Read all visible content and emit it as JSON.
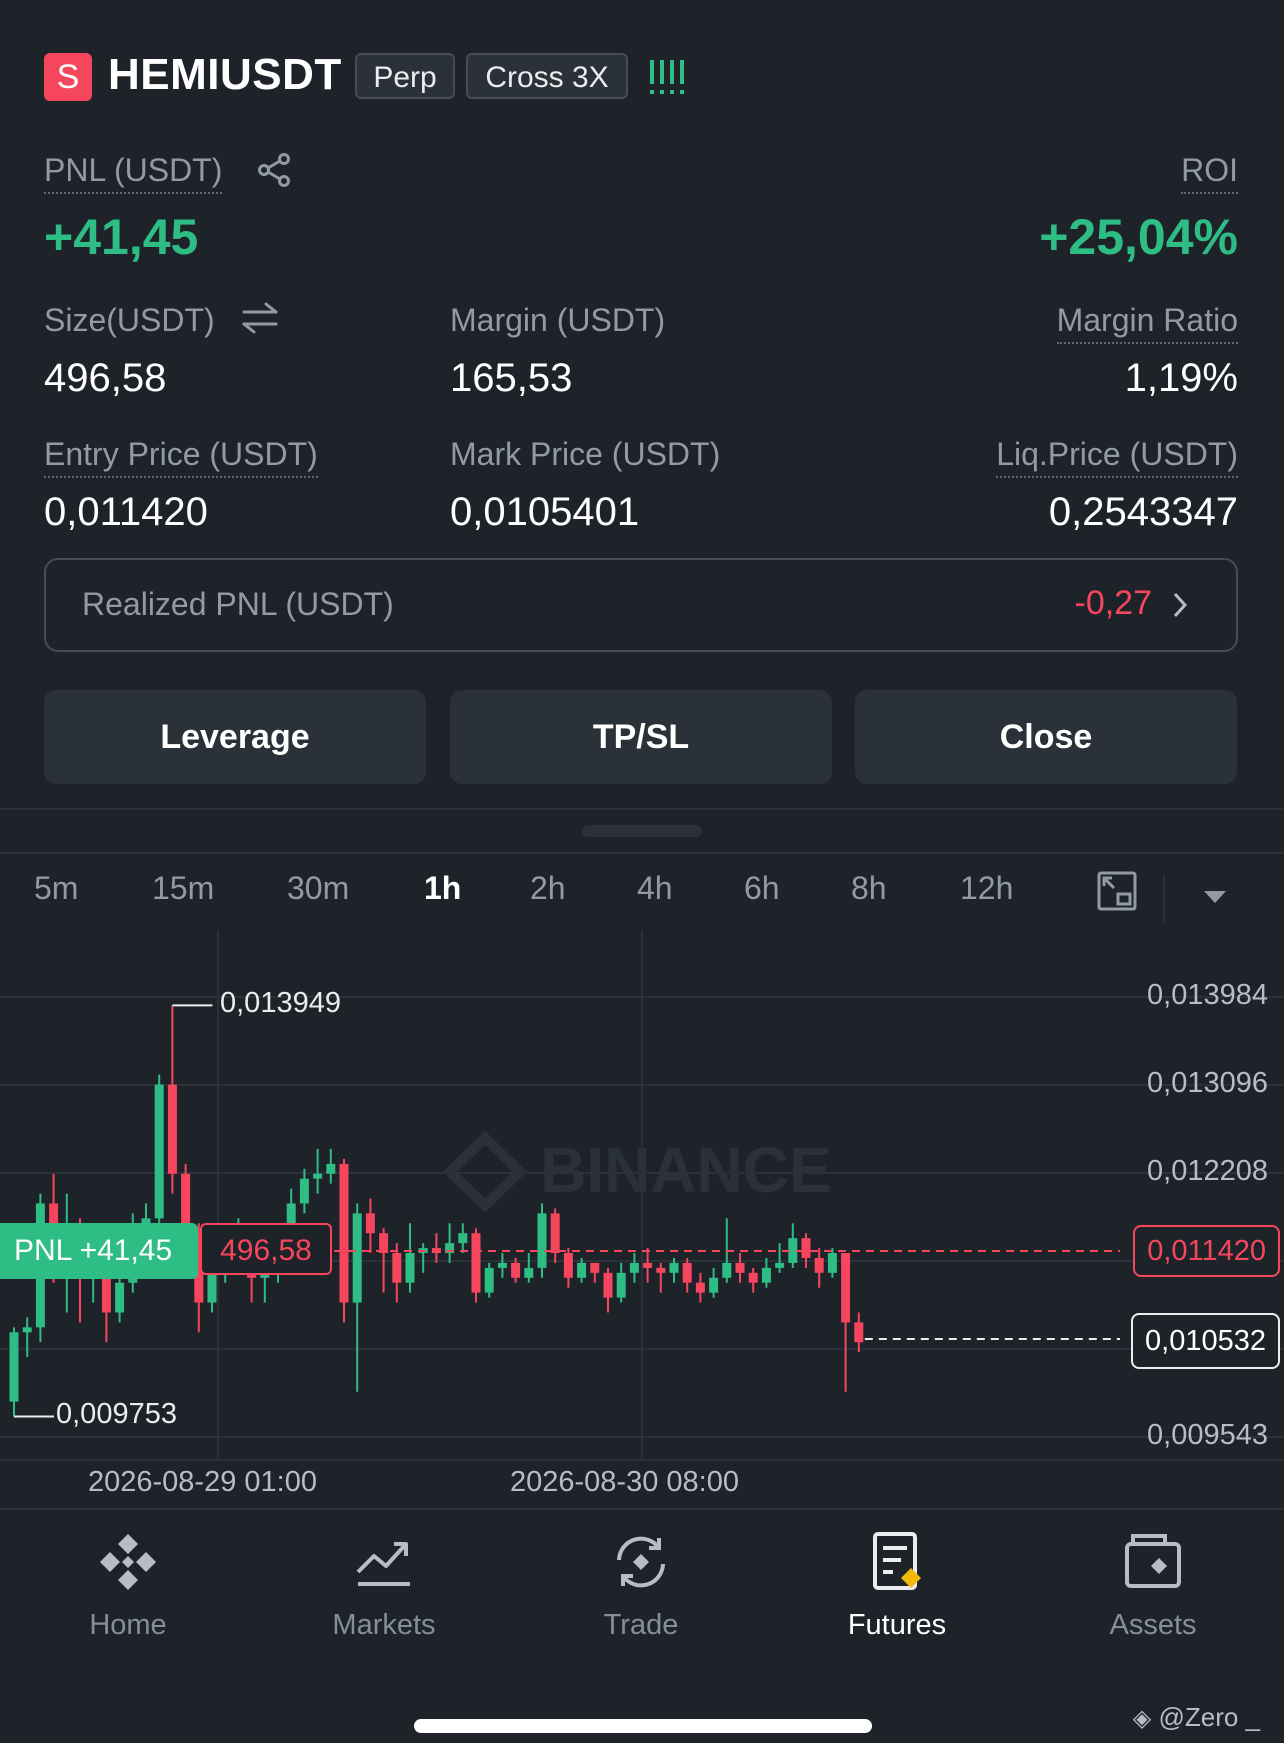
{
  "header": {
    "symbol_badge": "S",
    "symbol": "HEMIUSDT",
    "type_tag": "Perp",
    "margin_tag": "Cross 3X"
  },
  "position": {
    "pnl_label": "PNL (USDT)",
    "pnl_value": "+41,45",
    "roi_label": "ROI",
    "roi_value": "+25,04%",
    "size_label": "Size(USDT)",
    "size_value": "496,58",
    "margin_label": "Margin (USDT)",
    "margin_value": "165,53",
    "margin_ratio_label": "Margin Ratio",
    "margin_ratio_value": "1,19%",
    "entry_label": "Entry Price (USDT)",
    "entry_value": "0,011420",
    "mark_label": "Mark Price (USDT)",
    "mark_value": "0,0105401",
    "liq_label": "Liq.Price (USDT)",
    "liq_value": "0,2543347",
    "realized_label": "Realized PNL (USDT)",
    "realized_value": "-0,27"
  },
  "actions": {
    "leverage": "Leverage",
    "tpsl": "TP/SL",
    "close": "Close"
  },
  "timeframes": [
    "5m",
    "15m",
    "30m",
    "1h",
    "2h",
    "4h",
    "6h",
    "8h",
    "12h"
  ],
  "active_timeframe": "1h",
  "chart_data": {
    "type": "candlestick",
    "watermark": "BINANCE",
    "price_ticks": [
      "0,013984",
      "0,013096",
      "0,012208",
      "0,011420",
      "0,010532",
      "0,009543"
    ],
    "time_ticks": [
      "2026-08-29 01:00",
      "2026-08-30 08:00"
    ],
    "high_label": "0,013949",
    "low_label": "0,009753",
    "entry_line": {
      "price": 0.01142,
      "label": "0,011420",
      "pnl_tag": "PNL +41,45",
      "size_tag": "496,58"
    },
    "last_price": {
      "price": 0.010532,
      "label": "0,010532"
    },
    "ylim": [
      0.009543,
      0.013984
    ],
    "candles": [
      [
        0.0099,
        0.0106,
        0.00975,
        0.01065
      ],
      [
        0.0106,
        0.01065,
        0.01035,
        0.01075
      ],
      [
        0.01065,
        0.0119,
        0.0105,
        0.012
      ],
      [
        0.0119,
        0.0113,
        0.0111,
        0.0122
      ],
      [
        0.0113,
        0.0117,
        0.0108,
        0.012
      ],
      [
        0.0117,
        0.0112,
        0.0107,
        0.01175
      ],
      [
        0.0112,
        0.0113,
        0.0109,
        0.0116
      ],
      [
        0.0113,
        0.0108,
        0.0105,
        0.0114
      ],
      [
        0.0108,
        0.0111,
        0.0107,
        0.01135
      ],
      [
        0.0111,
        0.0116,
        0.011,
        0.0118
      ],
      [
        0.0116,
        0.01175,
        0.0114,
        0.0119
      ],
      [
        0.01175,
        0.0131,
        0.0116,
        0.0132
      ],
      [
        0.0131,
        0.0122,
        0.012,
        0.0139
      ],
      [
        0.0122,
        0.0116,
        0.0113,
        0.0123
      ],
      [
        0.0116,
        0.0109,
        0.0106,
        0.0117
      ],
      [
        0.0109,
        0.0113,
        0.0108,
        0.0114
      ],
      [
        0.0113,
        0.0114,
        0.0111,
        0.0115
      ],
      [
        0.0114,
        0.0115,
        0.0112,
        0.01175
      ],
      [
        0.0115,
        0.01115,
        0.0109,
        0.0116
      ],
      [
        0.01115,
        0.0112,
        0.0109,
        0.0113
      ],
      [
        0.0112,
        0.0115,
        0.0111,
        0.0116
      ],
      [
        0.0115,
        0.0119,
        0.0114,
        0.01205
      ],
      [
        0.0119,
        0.01215,
        0.0118,
        0.01225
      ],
      [
        0.01215,
        0.0122,
        0.012,
        0.01245
      ],
      [
        0.0122,
        0.0123,
        0.0121,
        0.01245
      ],
      [
        0.0123,
        0.0109,
        0.0107,
        0.01235
      ],
      [
        0.0109,
        0.0118,
        0.01,
        0.0119
      ],
      [
        0.0118,
        0.0116,
        0.0114,
        0.01195
      ],
      [
        0.0116,
        0.0114,
        0.011,
        0.01165
      ],
      [
        0.0114,
        0.0111,
        0.0109,
        0.0115
      ],
      [
        0.0111,
        0.0114,
        0.011,
        0.0117
      ],
      [
        0.0114,
        0.01145,
        0.0112,
        0.0115
      ],
      [
        0.01145,
        0.0114,
        0.0113,
        0.0116
      ],
      [
        0.0114,
        0.0115,
        0.0113,
        0.0117
      ],
      [
        0.0115,
        0.0116,
        0.0114,
        0.0117
      ],
      [
        0.0116,
        0.011,
        0.0109,
        0.01165
      ],
      [
        0.011,
        0.01125,
        0.01095,
        0.0113
      ],
      [
        0.01125,
        0.0113,
        0.01115,
        0.0114
      ],
      [
        0.0113,
        0.01115,
        0.0111,
        0.01135
      ],
      [
        0.01115,
        0.01125,
        0.0111,
        0.0114
      ],
      [
        0.01125,
        0.0118,
        0.01115,
        0.0119
      ],
      [
        0.0118,
        0.0114,
        0.0113,
        0.01185
      ],
      [
        0.0114,
        0.01115,
        0.01105,
        0.01145
      ],
      [
        0.01115,
        0.0113,
        0.0111,
        0.01135
      ],
      [
        0.0113,
        0.0112,
        0.0111,
        0.0113
      ],
      [
        0.0112,
        0.01095,
        0.0108,
        0.01125
      ],
      [
        0.01095,
        0.0112,
        0.0109,
        0.0113
      ],
      [
        0.0112,
        0.0113,
        0.0111,
        0.0114
      ],
      [
        0.0113,
        0.01125,
        0.0111,
        0.01145
      ],
      [
        0.01125,
        0.0112,
        0.011,
        0.0113
      ],
      [
        0.0112,
        0.0113,
        0.0111,
        0.01135
      ],
      [
        0.0113,
        0.0111,
        0.011,
        0.01135
      ],
      [
        0.0111,
        0.011,
        0.0109,
        0.0112
      ],
      [
        0.011,
        0.01115,
        0.01095,
        0.01125
      ],
      [
        0.01115,
        0.0113,
        0.0111,
        0.01175
      ],
      [
        0.0113,
        0.0112,
        0.0111,
        0.0114
      ],
      [
        0.0112,
        0.0111,
        0.011,
        0.01125
      ],
      [
        0.0111,
        0.01125,
        0.01105,
        0.01135
      ],
      [
        0.01125,
        0.0113,
        0.0112,
        0.0115
      ],
      [
        0.0113,
        0.01155,
        0.01125,
        0.0117
      ],
      [
        0.01155,
        0.01135,
        0.01125,
        0.0116
      ],
      [
        0.01135,
        0.0112,
        0.01105,
        0.01145
      ],
      [
        0.0112,
        0.0114,
        0.01115,
        0.01145
      ],
      [
        0.0114,
        0.0107,
        0.01,
        0.0114
      ],
      [
        0.0107,
        0.0105,
        0.0104,
        0.0108
      ]
    ]
  },
  "nav": [
    {
      "label": "Home",
      "icon": "binance-logo-icon"
    },
    {
      "label": "Markets",
      "icon": "chart-trend-icon"
    },
    {
      "label": "Trade",
      "icon": "trade-swap-icon"
    },
    {
      "label": "Futures",
      "icon": "futures-doc-icon"
    },
    {
      "label": "Assets",
      "icon": "wallet-icon"
    }
  ],
  "credit": "@Zero _",
  "colors": {
    "up": "#2ebd85",
    "down": "#f6465d",
    "bg": "#1e2329"
  }
}
